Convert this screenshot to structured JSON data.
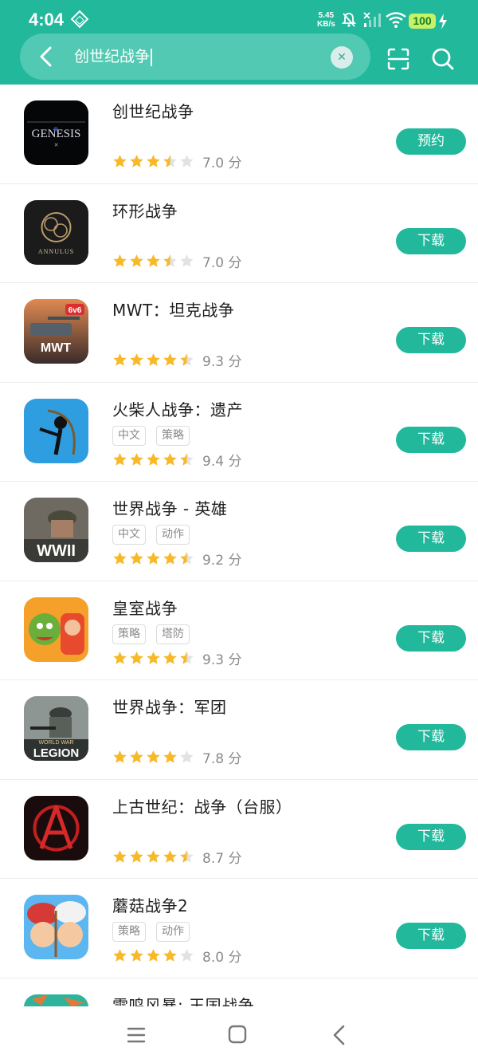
{
  "status_bar": {
    "time": "4:04",
    "net_speed_value": "5.45",
    "net_speed_unit": "KB/s",
    "battery": "100"
  },
  "search": {
    "query": "创世纪战争"
  },
  "results": [
    {
      "name": "创世纪战争",
      "tags": [],
      "rating": 3.5,
      "score": "7.0 分",
      "action": "预约",
      "icon": "genesis-icon"
    },
    {
      "name": "环形战争",
      "tags": [],
      "rating": 3.5,
      "score": "7.0 分",
      "action": "下载",
      "icon": "annulus-icon"
    },
    {
      "name": "MWT：坦克战争",
      "tags": [],
      "rating": 4.5,
      "score": "9.3 分",
      "action": "下载",
      "icon": "mwt-tank-icon"
    },
    {
      "name": "火柴人战争：遗产",
      "tags": [
        "中文",
        "策略"
      ],
      "rating": 4.5,
      "score": "9.4 分",
      "action": "下载",
      "icon": "stickman-icon"
    },
    {
      "name": "世界战争 - 英雄",
      "tags": [
        "中文",
        "动作"
      ],
      "rating": 4.5,
      "score": "9.2 分",
      "action": "下载",
      "icon": "wwii-icon"
    },
    {
      "name": "皇室战争",
      "tags": [
        "策略",
        "塔防"
      ],
      "rating": 4.5,
      "score": "9.3 分",
      "action": "下载",
      "icon": "clash-royale-icon"
    },
    {
      "name": "世界战争：军团",
      "tags": [],
      "rating": 4,
      "score": "7.8 分",
      "action": "下载",
      "icon": "legion-icon"
    },
    {
      "name": "上古世纪：战争（台服）",
      "tags": [],
      "rating": 4.5,
      "score": "8.7 分",
      "action": "下载",
      "icon": "archeage-icon"
    },
    {
      "name": "蘑菇战争2",
      "tags": [
        "策略",
        "动作"
      ],
      "rating": 4,
      "score": "8.0 分",
      "action": "下载",
      "icon": "mushroom-wars-icon"
    },
    {
      "name": "雷鸣风暴: 王国战争",
      "tags": [],
      "rating": 0,
      "score": "",
      "action": "",
      "icon": "thunderstorm-icon"
    }
  ],
  "colors": {
    "accent": "#22b89c",
    "star": "#f7b928",
    "star_empty": "#e2e2e2"
  }
}
